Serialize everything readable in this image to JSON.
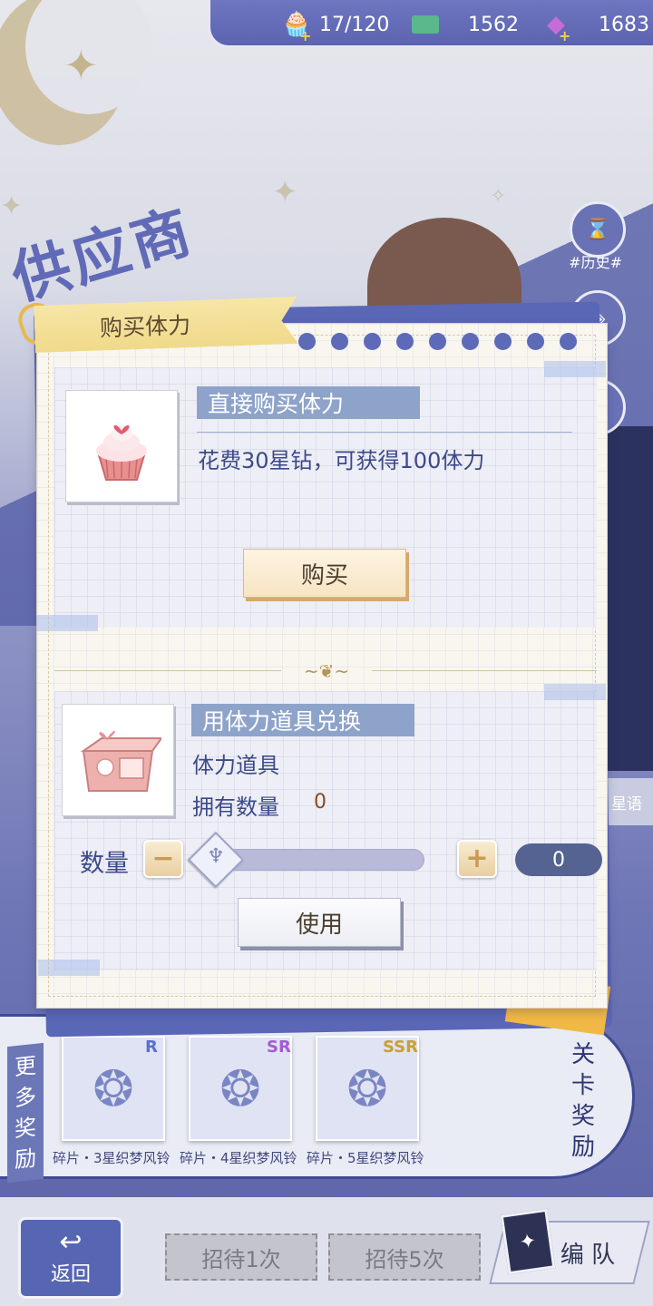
{
  "resources": {
    "stamina": {
      "icon": "cupcake-icon",
      "value": "17/120"
    },
    "coins": {
      "icon": "ticket-icon",
      "value": "1562"
    },
    "diamonds": {
      "icon": "swan-gem-icon",
      "value": "1683"
    }
  },
  "background": {
    "title": "供应商",
    "history_label": "#历史#",
    "side_tag": "星语"
  },
  "dialog": {
    "title": "购买体力",
    "direct": {
      "section_title": "直接购买体力",
      "description": "花费30星钻，可获得100体力",
      "buy_button": "购买",
      "item_icon": "cupcake-icon"
    },
    "exchange": {
      "section_title": "用体力道具兑换",
      "item_name": "体力道具",
      "owned_label": "拥有数量",
      "owned_count": "0",
      "quantity_label": "数量",
      "minus": "−",
      "plus": "+",
      "quantity_value": "0",
      "slider_fraction": 0,
      "use_button": "使用",
      "item_icon": "gift-box-icon"
    }
  },
  "stage": {
    "more_rewards": [
      "更",
      "多",
      "奖",
      "励"
    ],
    "stage_rewards": [
      "关",
      "卡",
      "奖",
      "励"
    ],
    "rewards": [
      {
        "rank": "R",
        "rank_color": "#5b6fd0",
        "caption": "碎片・3星织梦风铃"
      },
      {
        "rank": "SR",
        "rank_color": "#a45bd0",
        "caption": "碎片・4星织梦风铃"
      },
      {
        "rank": "SSR",
        "rank_color": "#c9a032",
        "caption": "碎片・5星织梦风铃"
      }
    ]
  },
  "bottom": {
    "back": "返回",
    "invite_1": "招待1次",
    "invite_5": "招待5次",
    "team": "编 队"
  },
  "colors": {
    "accent_blue": "#5d6ab8",
    "ribbon": "#f0d98a",
    "button_shadow": "#d6a86a",
    "value_brown": "#8a4a1e"
  }
}
